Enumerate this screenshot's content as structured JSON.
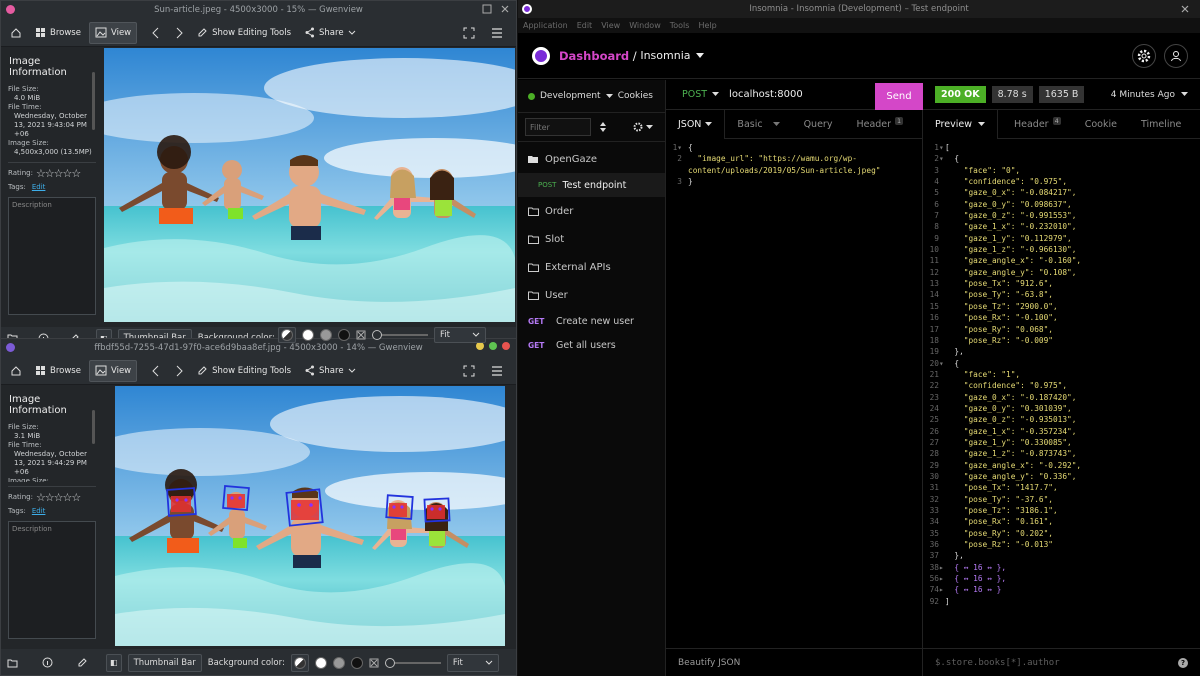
{
  "gw1": {
    "title": "Sun-article.jpeg - 4500x3000 - 15% — Gwenview",
    "browse": "Browse",
    "view": "View",
    "editing": "Show Editing Tools",
    "share": "Share",
    "panel_title": "Image Information",
    "file_size_label": "File Size:",
    "file_size": "4.0 MiB",
    "file_time_label": "File Time:",
    "file_time": [
      "Wednesday, October",
      "13, 2021 9:43:04 PM",
      "+06"
    ],
    "image_size_label": "Image Size:",
    "image_size": "4,500x3,000 (13.5MP)",
    "rating_label": "Rating:",
    "tags_label": "Tags:",
    "tags_edit": "Edit",
    "description": "Description",
    "thumbnail_bar": "Thumbnail Bar",
    "bg_color": "Background color:",
    "fit": "Fit"
  },
  "gw2": {
    "title": "ffbdf55d-7255-47d1-97f0-ace6d9baa8ef.jpg - 4500x3000 - 14% — Gwenview",
    "browse": "Browse",
    "view": "View",
    "editing": "Show Editing Tools",
    "share": "Share",
    "panel_title": "Image Information",
    "file_size_label": "File Size:",
    "file_size": "3.1 MiB",
    "file_time_label": "File Time:",
    "file_time": [
      "Wednesday, October",
      "13, 2021 9:44:29 PM",
      "+06"
    ],
    "image_size_label": "Image Size:",
    "rating_label": "Rating:",
    "tags_label": "Tags:",
    "tags_edit": "Edit",
    "description": "Description",
    "thumbnail_bar": "Thumbnail Bar",
    "bg_color": "Background color:",
    "fit": "Fit"
  },
  "insomnia": {
    "title": "Insomnia - Insomnia (Development) – Test endpoint",
    "menu": [
      "Application",
      "Edit",
      "View",
      "Window",
      "Tools",
      "Help"
    ],
    "breadcrumb_dashboard": "Dashboard",
    "breadcrumb_sep": " / ",
    "breadcrumb_project": "Insomnia",
    "environment": "Development",
    "cookies": "Cookies",
    "filter_placeholder": "Filter",
    "method": "POST",
    "url": "localhost:8000",
    "send": "Send",
    "status": "200 OK",
    "time": "8.78 s",
    "size": "1635 B",
    "age": "4 Minutes Ago",
    "sidebar": [
      {
        "type": "folder-open",
        "label": "OpenGaze"
      },
      {
        "type": "request",
        "method": "POST",
        "label": "Test endpoint"
      },
      {
        "type": "folder",
        "label": "Order"
      },
      {
        "type": "folder",
        "label": "Slot"
      },
      {
        "type": "folder",
        "label": "External APIs"
      },
      {
        "type": "folder",
        "label": "User"
      },
      {
        "type": "request",
        "method": "GET",
        "label": "Create new user"
      },
      {
        "type": "request",
        "method": "GET",
        "label": "Get all users"
      }
    ],
    "req_tabs": {
      "json": "JSON",
      "basic": "Basic",
      "query": "Query",
      "header": "Header",
      "header_count": "1"
    },
    "req_body": [
      "{",
      "  \"image_url\": \"https://wamu.org/wp-",
      "content/uploads/2019/05/Sun-article.jpeg\"",
      "}"
    ],
    "beautify": "Beautify JSON",
    "res_tabs": {
      "preview": "Preview",
      "header": "Header",
      "header_count": "4",
      "cookie": "Cookie",
      "timeline": "Timeline"
    },
    "filter_query": "$.store.books[*].author",
    "res_lines": [
      {
        "n": "1",
        "f": true,
        "t": "["
      },
      {
        "n": "2",
        "f": true,
        "t": "  {"
      },
      {
        "n": "3",
        "t": "    \"face\": \"0\","
      },
      {
        "n": "4",
        "t": "    \"confidence\": \"0.975\","
      },
      {
        "n": "5",
        "t": "    \"gaze_0_x\": \"-0.084217\","
      },
      {
        "n": "6",
        "t": "    \"gaze_0_y\": \"0.098637\","
      },
      {
        "n": "7",
        "t": "    \"gaze_0_z\": \"-0.991553\","
      },
      {
        "n": "8",
        "t": "    \"gaze_1_x\": \"-0.232010\","
      },
      {
        "n": "9",
        "t": "    \"gaze_1_y\": \"0.112979\","
      },
      {
        "n": "10",
        "t": "    \"gaze_1_z\": \"-0.966130\","
      },
      {
        "n": "11",
        "t": "    \"gaze_angle_x\": \"-0.160\","
      },
      {
        "n": "12",
        "t": "    \"gaze_angle_y\": \"0.108\","
      },
      {
        "n": "13",
        "t": "    \"pose_Tx\": \"912.6\","
      },
      {
        "n": "14",
        "t": "    \"pose_Ty\": \"-63.8\","
      },
      {
        "n": "15",
        "t": "    \"pose_Tz\": \"2900.0\","
      },
      {
        "n": "16",
        "t": "    \"pose_Rx\": \"-0.100\","
      },
      {
        "n": "17",
        "t": "    \"pose_Ry\": \"0.068\","
      },
      {
        "n": "18",
        "t": "    \"pose_Rz\": \"-0.009\""
      },
      {
        "n": "19",
        "t": "  },"
      },
      {
        "n": "20",
        "f": true,
        "t": "  {"
      },
      {
        "n": "21",
        "t": "    \"face\": \"1\","
      },
      {
        "n": "22",
        "t": "    \"confidence\": \"0.975\","
      },
      {
        "n": "23",
        "t": "    \"gaze_0_x\": \"-0.187420\","
      },
      {
        "n": "24",
        "t": "    \"gaze_0_y\": \"0.301039\","
      },
      {
        "n": "25",
        "t": "    \"gaze_0_z\": \"-0.935013\","
      },
      {
        "n": "26",
        "t": "    \"gaze_1_x\": \"-0.357234\","
      },
      {
        "n": "27",
        "t": "    \"gaze_1_y\": \"0.330085\","
      },
      {
        "n": "28",
        "t": "    \"gaze_1_z\": \"-0.873743\","
      },
      {
        "n": "29",
        "t": "    \"gaze_angle_x\": \"-0.292\","
      },
      {
        "n": "30",
        "t": "    \"gaze_angle_y\": \"0.336\","
      },
      {
        "n": "31",
        "t": "    \"pose_Tx\": \"1417.7\","
      },
      {
        "n": "32",
        "t": "    \"pose_Ty\": \"-37.6\","
      },
      {
        "n": "33",
        "t": "    \"pose_Tz\": \"3186.1\","
      },
      {
        "n": "34",
        "t": "    \"pose_Rx\": \"0.161\","
      },
      {
        "n": "35",
        "t": "    \"pose_Ry\": \"0.202\","
      },
      {
        "n": "36",
        "t": "    \"pose_Rz\": \"-0.013\""
      },
      {
        "n": "37",
        "t": "  },"
      },
      {
        "n": "38",
        "c": true,
        "t": "  { ↔ 16 ↔ },"
      },
      {
        "n": "56",
        "c": true,
        "t": "  { ↔ 16 ↔ },"
      },
      {
        "n": "74",
        "c": true,
        "t": "  { ↔ 16 ↔ }"
      },
      {
        "n": "92",
        "t": "]"
      }
    ]
  },
  "colors": {
    "accent": "#d447c8",
    "send_bg": "#d447c8",
    "status_ok": "#4caf26",
    "post": "#4cb050",
    "get": "#b57af5"
  }
}
